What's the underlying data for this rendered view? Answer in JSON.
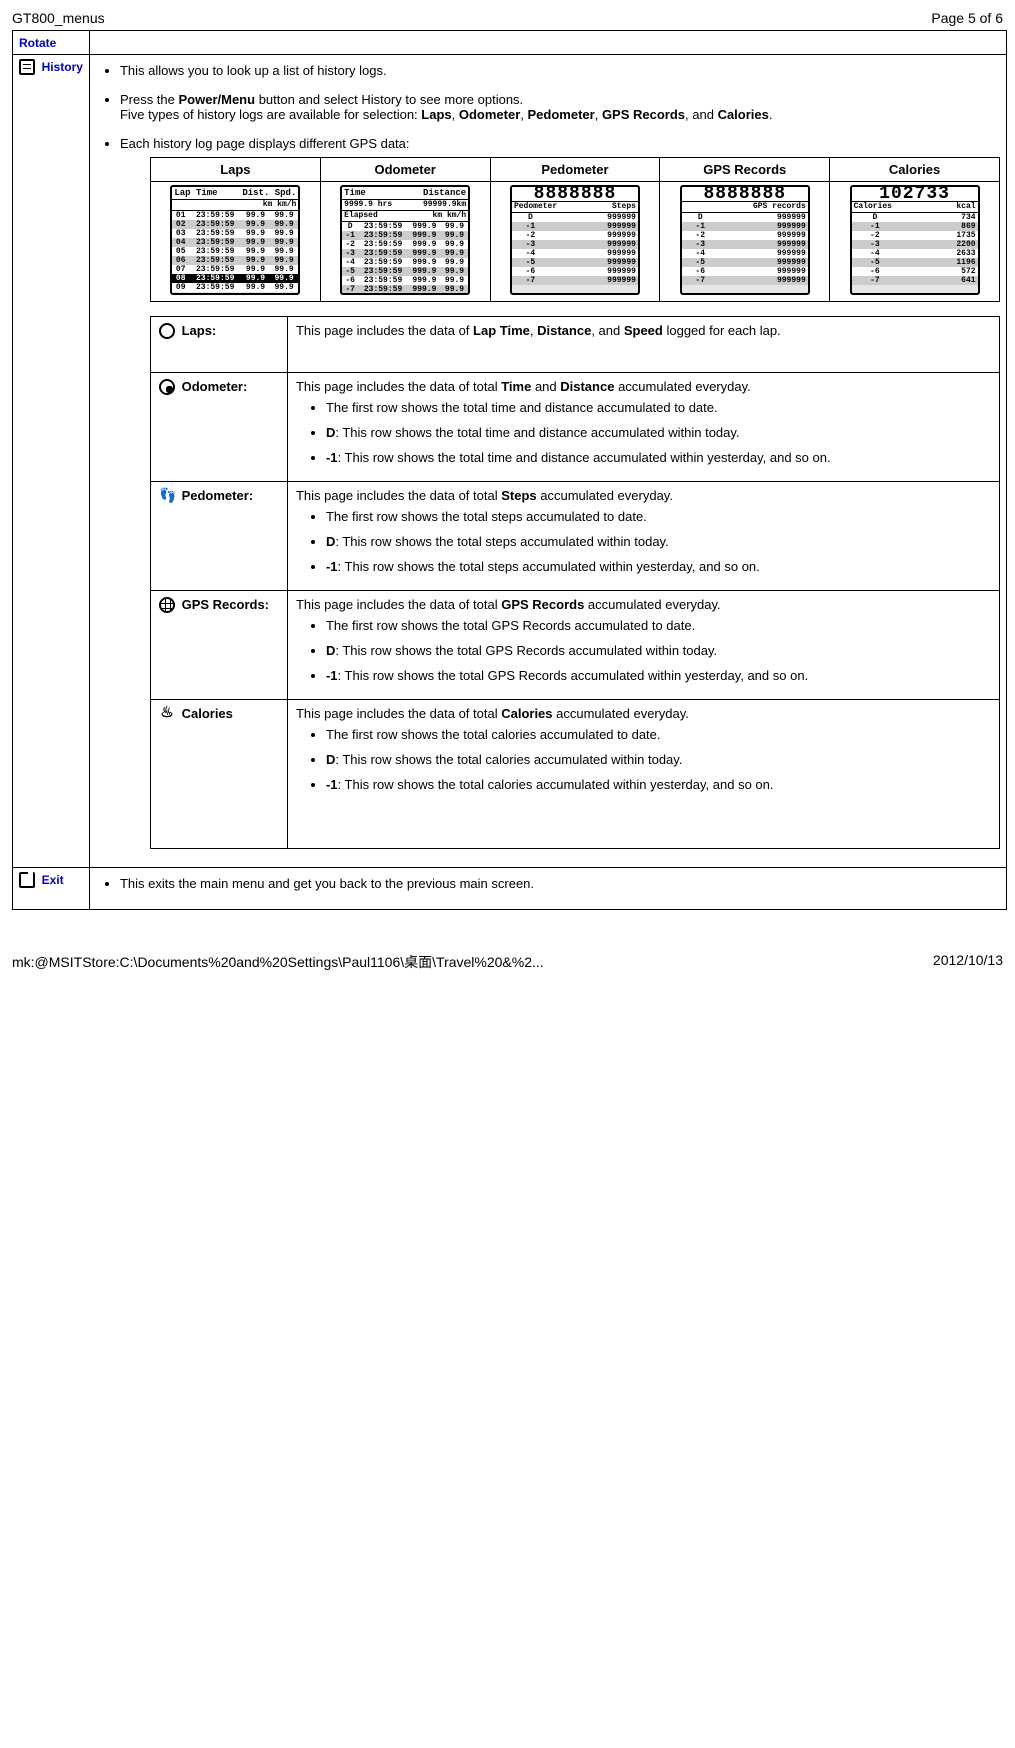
{
  "header": {
    "doc_title": "GT800_menus",
    "page_indicator": "Page 5 of 6"
  },
  "rows": {
    "rotate": {
      "label": "Rotate"
    },
    "history": {
      "label": "History",
      "intro1": "This allows you to look up a list of history logs.",
      "intro2_pre": "Press the ",
      "intro2_btn": "Power/Menu",
      "intro2_post": " button and select History to see more options.",
      "intro2_line2_pre": "Five types of history logs are available for selection: ",
      "b1": "Laps",
      "c1": ", ",
      "b2": "Odometer",
      "c2": ", ",
      "b3": "Pedometer",
      "c3": ", ",
      "b4": "GPS Records",
      "c4": ", and ",
      "b5": "Calories",
      "c5": ".",
      "intro3": "Each history log page displays different GPS data:"
    },
    "exit": {
      "label": "Exit",
      "text": "This exits the main menu and get you back to the previous main screen."
    }
  },
  "lcd_headers": {
    "laps": "Laps",
    "odometer": "Odometer",
    "pedometer": "Pedometer",
    "gps": "GPS Records",
    "calories": "Calories"
  },
  "lcd_laps": {
    "title_l": "Lap Time",
    "title_r": "Dist. Spd.",
    "unit_l": "",
    "unit_r": "km km/h",
    "rows": [
      [
        "01",
        "23:59:59",
        "99.9",
        "99.9"
      ],
      [
        "02",
        "23:59:59",
        "99.9",
        "99.9"
      ],
      [
        "03",
        "23:59:59",
        "99.9",
        "99.9"
      ],
      [
        "04",
        "23:59:59",
        "99.9",
        "99.9"
      ],
      [
        "05",
        "23:59:59",
        "99.9",
        "99.9"
      ],
      [
        "06",
        "23:59:59",
        "99.9",
        "99.9"
      ],
      [
        "07",
        "23:59:59",
        "99.9",
        "99.9"
      ],
      [
        "08",
        "23:59:59",
        "99.9",
        "99.9"
      ],
      [
        "09",
        "23:59:59",
        "99.9",
        "99.9"
      ]
    ],
    "sel_index": 7
  },
  "lcd_odo": {
    "title_l": "Time",
    "title_r": "Distance",
    "val_l": "9999.9 hrs",
    "val_r": "99999.9km",
    "unit_l": "Elapsed",
    "unit_r": "km km/h",
    "rows": [
      [
        "D",
        "23:59:59",
        "999.9",
        "99.9"
      ],
      [
        "-1",
        "23:59:59",
        "999.9",
        "99.9"
      ],
      [
        "-2",
        "23:59:59",
        "999.9",
        "99.9"
      ],
      [
        "-3",
        "23:59:59",
        "999.9",
        "99.9"
      ],
      [
        "-4",
        "23:59:59",
        "999.9",
        "99.9"
      ],
      [
        "-5",
        "23:59:59",
        "999.9",
        "99.9"
      ],
      [
        "-6",
        "23:59:59",
        "999.9",
        "99.9"
      ],
      [
        "-7",
        "23:59:59",
        "999.9",
        "99.9"
      ]
    ]
  },
  "lcd_pedo": {
    "big": "8888888",
    "sub_l": "Pedometer",
    "sub_r": "Steps",
    "rows": [
      [
        "D",
        "999999"
      ],
      [
        "-1",
        "999999"
      ],
      [
        "-2",
        "999999"
      ],
      [
        "-3",
        "999999"
      ],
      [
        "-4",
        "999999"
      ],
      [
        "-5",
        "999999"
      ],
      [
        "-6",
        "999999"
      ],
      [
        "-7",
        "999999"
      ]
    ]
  },
  "lcd_gps": {
    "big": "8888888",
    "sub_l": "",
    "sub_r": "GPS records",
    "rows": [
      [
        "D",
        "999999"
      ],
      [
        "-1",
        "999999"
      ],
      [
        "-2",
        "999999"
      ],
      [
        "-3",
        "999999"
      ],
      [
        "-4",
        "999999"
      ],
      [
        "-5",
        "999999"
      ],
      [
        "-6",
        "999999"
      ],
      [
        "-7",
        "999999"
      ]
    ]
  },
  "lcd_cal": {
    "big": "102733",
    "sub_l": "Calories",
    "sub_r": "kcal",
    "rows": [
      [
        "D",
        "734"
      ],
      [
        "-1",
        "869"
      ],
      [
        "-2",
        "1735"
      ],
      [
        "-3",
        "2200"
      ],
      [
        "-4",
        "2633"
      ],
      [
        "-5",
        "1196"
      ],
      [
        "-6",
        "572"
      ],
      [
        "-7",
        "641"
      ]
    ]
  },
  "details": {
    "laps": {
      "label": "Laps:",
      "p_pre": "This page includes the data of ",
      "b1": "Lap Time",
      "c1": ", ",
      "b2": "Distance",
      "c2": ", and ",
      "b3": "Speed",
      "p_post": " logged for each lap."
    },
    "odometer": {
      "label": "Odometer:",
      "p_pre": "This page includes the data of total ",
      "b1": "Time",
      "c1": " and ",
      "b2": "Distance",
      "p_post": " accumulated everyday.",
      "li1": "The first row shows the total time and distance accumulated to date.",
      "li2_b": "D",
      "li2": ": This row shows the total time and distance accumulated within today.",
      "li3_b": "-1",
      "li3": ": This row shows the total time and distance accumulated within yesterday, and so on."
    },
    "pedometer": {
      "label": "Pedometer:",
      "p_pre": "This page includes the data of total ",
      "b1": "Steps",
      "p_post": " accumulated everyday.",
      "li1": "The first row shows the total steps accumulated to date.",
      "li2_b": "D",
      "li2": ": This row shows the total steps accumulated within today.",
      "li3_b": "-1",
      "li3": ": This row shows the total steps accumulated within yesterday, and so on."
    },
    "gps": {
      "label": "GPS Records:",
      "p_pre": "This page includes the data of total ",
      "b1": "GPS Records",
      "p_post": " accumulated everyday.",
      "li1": "The first row shows the total GPS Records accumulated to date.",
      "li2_b": "D",
      "li2": ": This row shows the total GPS Records accumulated within today.",
      "li3_b": "-1",
      "li3": ": This row shows the total GPS Records accumulated within yesterday, and so on."
    },
    "calories": {
      "label": "Calories",
      "p_pre": "This page includes the data of total ",
      "b1": "Calories",
      "p_post": " accumulated everyday.",
      "li1": "The first row shows the total calories accumulated to date.",
      "li2_b": "D",
      "li2": ": This row shows the total calories accumulated within today.",
      "li3_b": "-1",
      "li3": ": This row shows the total calories accumulated within yesterday, and so on."
    }
  },
  "footer": {
    "path": "mk:@MSITStore:C:\\Documents%20and%20Settings\\Paul1106\\桌面\\Travel%20&%2...",
    "date": "2012/10/13"
  }
}
